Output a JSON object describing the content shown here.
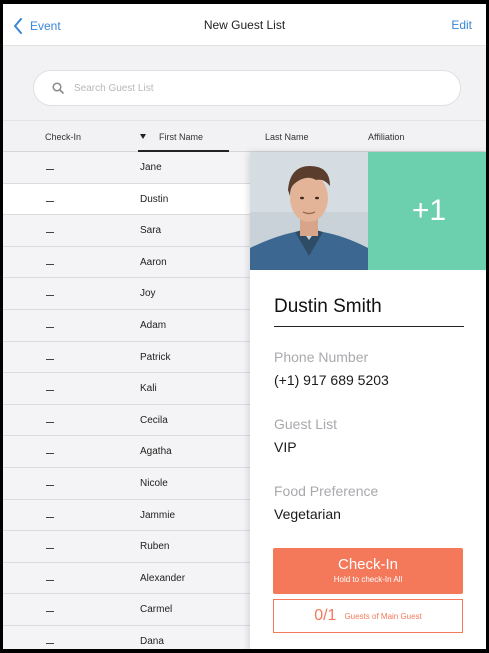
{
  "nav": {
    "back_label": "Event",
    "title": "New Guest List",
    "edit_label": "Edit"
  },
  "search": {
    "placeholder": "Search Guest List",
    "value": ""
  },
  "columns": [
    "Check-In",
    "First Name",
    "Last Name",
    "Affiliation"
  ],
  "sort": {
    "column": "First Name",
    "direction": "descending"
  },
  "guests": [
    {
      "checkin": "",
      "first_name": "Jane"
    },
    {
      "checkin": "",
      "first_name": "Dustin",
      "selected": true
    },
    {
      "checkin": "",
      "first_name": "Sara"
    },
    {
      "checkin": "",
      "first_name": "Aaron"
    },
    {
      "checkin": "",
      "first_name": "Joy"
    },
    {
      "checkin": "",
      "first_name": "Adam"
    },
    {
      "checkin": "",
      "first_name": "Patrick"
    },
    {
      "checkin": "",
      "first_name": "Kali"
    },
    {
      "checkin": "",
      "first_name": "Cecila"
    },
    {
      "checkin": "",
      "first_name": "Agatha"
    },
    {
      "checkin": "",
      "first_name": "Nicole"
    },
    {
      "checkin": "",
      "first_name": "Jammie"
    },
    {
      "checkin": "",
      "first_name": "Ruben"
    },
    {
      "checkin": "",
      "first_name": "Alexander"
    },
    {
      "checkin": "",
      "first_name": "Carmel"
    },
    {
      "checkin": "",
      "first_name": "Dana"
    }
  ],
  "detail": {
    "name": "Dustin Smith",
    "plus_guests": "+1",
    "phone_label": "Phone Number",
    "phone": "(+1) 917 689 5203",
    "guest_list_label": "Guest List",
    "guest_list": "VIP",
    "food_label": "Food Preference",
    "food": "Vegetarian",
    "checkin_button": "Check-In",
    "checkin_sub": "Hold to check-In All",
    "guests_count": "0/1",
    "guests_label": "Guests of Main Guest"
  },
  "icons": {
    "back": "chevron-left-icon",
    "search": "search-icon",
    "sort": "sort-down-icon"
  },
  "colors": {
    "accent": "#3a86d8",
    "checkin": "#f4795a",
    "plus": "#6ccfae"
  }
}
